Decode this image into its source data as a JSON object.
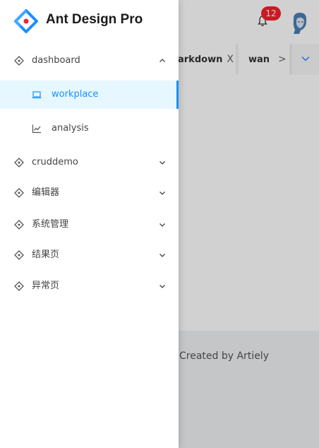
{
  "app": {
    "title": "Ant Design Pro"
  },
  "header": {
    "notification_count": "12"
  },
  "tabs": [
    {
      "label": "arkdown",
      "close": "X"
    },
    {
      "label": "wan",
      "scroll": ">"
    }
  ],
  "footer": {
    "text": "Created by Artiely"
  },
  "menu": {
    "dashboard": {
      "label": "dashboard",
      "children": [
        {
          "label": "workplace"
        },
        {
          "label": "analysis"
        }
      ]
    },
    "items": [
      {
        "label": "cruddemo"
      },
      {
        "label": "编辑器"
      },
      {
        "label": "系统管理"
      },
      {
        "label": "结果页"
      },
      {
        "label": "异常页"
      }
    ]
  },
  "colors": {
    "accent": "#1890ff",
    "badge": "#f5222d",
    "active_bg": "#e6f7ff"
  }
}
